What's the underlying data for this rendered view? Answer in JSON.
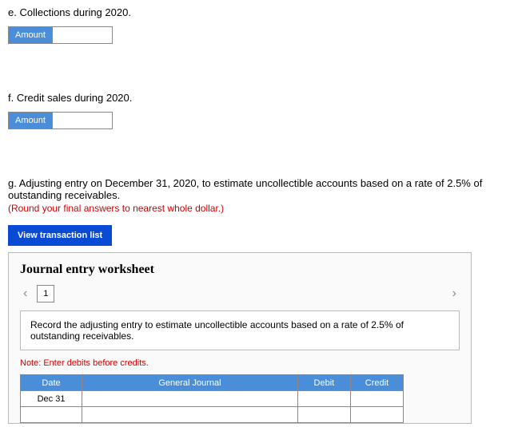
{
  "e": {
    "prompt": "e. Collections during 2020.",
    "label": "Amount",
    "value": ""
  },
  "f": {
    "prompt": "f. Credit sales during 2020.",
    "label": "Amount",
    "value": ""
  },
  "g": {
    "prompt": "g. Adjusting entry on December 31, 2020, to estimate uncollectible accounts based on a rate of 2.5% of outstanding receivables.",
    "instruction": "(Round your final answers to nearest whole dollar.)"
  },
  "viewButton": "View transaction list",
  "worksheet": {
    "title": "Journal entry worksheet",
    "page": "1",
    "instruction": "Record the adjusting entry to estimate uncollectible accounts based on a rate of 2.5% of outstanding receivables.",
    "note": "Note: Enter debits before credits.",
    "headers": {
      "date": "Date",
      "gj": "General Journal",
      "debit": "Debit",
      "credit": "Credit"
    },
    "rows": [
      {
        "date": "Dec 31",
        "gj": "",
        "debit": "",
        "credit": ""
      },
      {
        "date": "",
        "gj": "",
        "debit": "",
        "credit": ""
      }
    ]
  }
}
